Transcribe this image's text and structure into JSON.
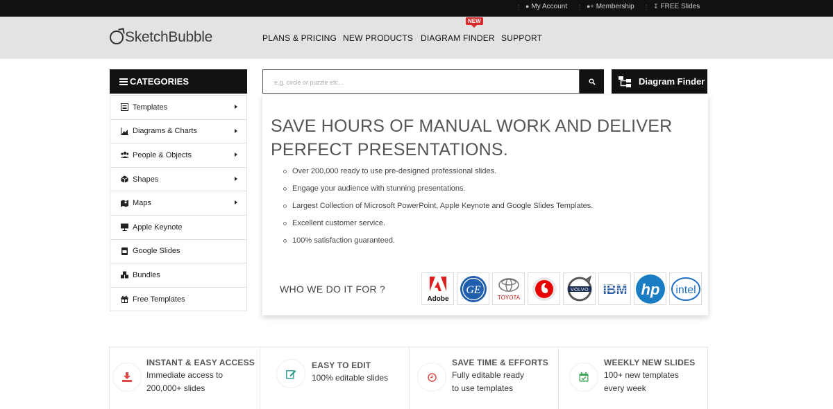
{
  "topbar": {
    "my_account": "My Account",
    "membership": "Membership",
    "free_slides": "FREE Slides"
  },
  "header": {
    "logo_text": "SketchBubble",
    "nav": [
      {
        "label": "PLANS & PRICING"
      },
      {
        "label": "NEW PRODUCTS"
      },
      {
        "label": "DIAGRAM FINDER"
      },
      {
        "label": "SUPPORT"
      }
    ],
    "new_badge": "NEW"
  },
  "categories": {
    "title": "CATEGORIES",
    "items": [
      {
        "label": "Templates",
        "icon": "templates-icon",
        "has_submenu": true
      },
      {
        "label": "Diagrams & Charts",
        "icon": "chart-icon",
        "has_submenu": true
      },
      {
        "label": "People & Objects",
        "icon": "people-icon",
        "has_submenu": true
      },
      {
        "label": "Shapes",
        "icon": "cube-icon",
        "has_submenu": true
      },
      {
        "label": "Maps",
        "icon": "map-icon",
        "has_submenu": true
      },
      {
        "label": "Apple Keynote",
        "icon": "keynote-icon",
        "has_submenu": false
      },
      {
        "label": "Google Slides",
        "icon": "slides-icon",
        "has_submenu": false
      },
      {
        "label": "Bundles",
        "icon": "bundles-icon",
        "has_submenu": false
      },
      {
        "label": "Free Templates",
        "icon": "gift-icon",
        "has_submenu": false
      }
    ]
  },
  "search": {
    "placeholder": "e.g. circle or puzzle etc..."
  },
  "diagram_finder_button": "Diagram Finder",
  "hero": {
    "title": "SAVE HOURS OF MANUAL WORK AND DELIVER PERFECT PRESENTATIONS.",
    "bullets": [
      "Over 200,000 ready to use pre-designed professional slides.",
      "Engage your audience with stunning presentations.",
      "Largest Collection of Microsoft PowerPoint, Apple Keynote and Google Slides Templates.",
      "Excellent customer service.",
      "100% satisfaction guaranteed."
    ],
    "who_label": "WHO WE DO IT FOR ?",
    "clients": [
      {
        "name": "Adobe"
      },
      {
        "name": "GE"
      },
      {
        "name": "TOYOTA"
      },
      {
        "name": "Vodafone"
      },
      {
        "name": "VOLVO"
      },
      {
        "name": "IBM"
      },
      {
        "name": "hp"
      },
      {
        "name": "intel"
      }
    ]
  },
  "features": [
    {
      "title": "INSTANT & EASY ACCESS",
      "line1": "Immediate access to",
      "line2": "200,000+ slides",
      "icon": "download-icon",
      "color": "#e04848"
    },
    {
      "title": "EASY TO EDIT",
      "line1": "100% editable slides",
      "line2": "",
      "icon": "edit-icon",
      "color": "#2a9a8e"
    },
    {
      "title": "SAVE TIME & EFFORTS",
      "line1": "Fully editable ready",
      "line2": "to use templates",
      "icon": "clock-icon",
      "color": "#e04848"
    },
    {
      "title": "WEEKLY NEW SLIDES",
      "line1": "100+ new templates",
      "line2": "every week",
      "icon": "calendar-icon",
      "color": "#3aa655"
    }
  ]
}
